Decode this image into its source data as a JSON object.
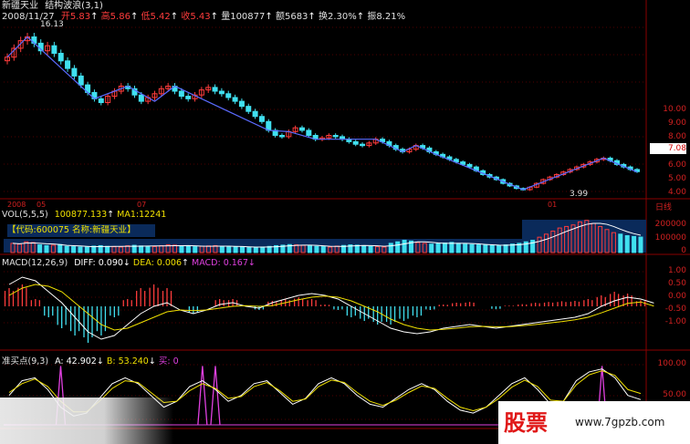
{
  "header": {
    "stock_name": "新疆天业",
    "indicator": "结构波浪(3,1)",
    "date": "2008/11/27",
    "open_label": "开",
    "open_value": "5.83",
    "high_label": "高",
    "high_value": "5.86",
    "low_label": "低",
    "low_value": "5.42",
    "close_label": "收",
    "close_value": "5.43",
    "volume_label": "量",
    "volume_value": "100877",
    "amount_label": "额",
    "amount_value": "5683",
    "turnover_label": "换",
    "turnover_value": "2.30%",
    "amplitude_label": "振",
    "amplitude_value": "8.21%"
  },
  "price_panel": {
    "y_ticks": [
      "10.00",
      "9.00",
      "8.00",
      "7.00",
      "6.00",
      "5.00",
      "4.00"
    ],
    "current_price": "7.08",
    "date_labels": [
      "2008",
      "05",
      "07",
      "01"
    ],
    "right_label": "日线",
    "high_mark": "16.13",
    "low_mark": "3.99"
  },
  "volume_panel": {
    "title": "VOL(5,5,5)",
    "value": "100877.133",
    "ma_label": "MA1:12241",
    "code_label": "【代码:600075 名称:新疆天业】",
    "y_ticks": [
      "200000",
      "100000",
      "0"
    ]
  },
  "macd_panel": {
    "title": "MACD(12,26,9)",
    "diff": "DIFF: 0.090",
    "dea": "DEA: 0.006",
    "macd": "MACD: 0.167",
    "y_ticks": [
      "1.00",
      "0.50",
      "0.00",
      "-0.50",
      "-1.00"
    ]
  },
  "kdj_panel": {
    "title": "准买点(9,3)",
    "a_value": "A: 42.902",
    "b_value": "B: 53.240",
    "buy_label": "买: 0",
    "y_ticks": [
      "100.00",
      "50.00"
    ]
  },
  "watermark": {
    "brand": "股票",
    "url": "www.7gpzb.com"
  },
  "colors": {
    "up": "#ff3c3c",
    "down": "#40e0f0",
    "wave": "#5a6bff",
    "white_line": "#ffffff",
    "yellow_line": "#f0e000",
    "magenta": "#e040e0",
    "grid": "#8a0000",
    "label_red": "#d02020"
  },
  "chart_data": [
    {
      "type": "candlestick",
      "title": "结构波浪(3,1)",
      "ylim": [
        3.5,
        17
      ],
      "close_series_approx": [
        14.5,
        15.2,
        15.8,
        16.1,
        15.6,
        15.0,
        15.4,
        14.8,
        14.2,
        13.6,
        13.0,
        12.3,
        11.7,
        11.2,
        10.9,
        11.4,
        11.8,
        12.2,
        12.0,
        11.5,
        11.0,
        11.3,
        11.6,
        12.0,
        12.2,
        11.8,
        11.4,
        11.2,
        11.5,
        11.9,
        12.1,
        11.8,
        11.6,
        11.3,
        11.0,
        10.6,
        10.2,
        9.8,
        9.4,
        8.7,
        8.3,
        8.2,
        8.6,
        8.9,
        8.7,
        8.3,
        8.0,
        8.1,
        8.3,
        8.2,
        8.0,
        7.8,
        7.6,
        7.5,
        7.7,
        8.0,
        7.8,
        7.5,
        7.2,
        7.0,
        7.2,
        7.5,
        7.3,
        7.0,
        6.8,
        6.6,
        6.4,
        6.2,
        6.0,
        5.8,
        5.5,
        5.2,
        5.0,
        4.8,
        4.5,
        4.3,
        4.1,
        4.0,
        4.2,
        4.5,
        4.8,
        5.0,
        5.2,
        5.4,
        5.6,
        5.8,
        6.0,
        6.2,
        6.4,
        6.5,
        6.3,
        6.0,
        5.8,
        5.6,
        5.43
      ],
      "annotations": [
        "16.13",
        "3.99"
      ],
      "wave_points_approx": [
        [
          0,
          14.5
        ],
        [
          3,
          16.1
        ],
        [
          13,
          11.2
        ],
        [
          18,
          12.2
        ],
        [
          22,
          11.0
        ],
        [
          25,
          12.2
        ],
        [
          39,
          8.7
        ],
        [
          42,
          8.6
        ],
        [
          46,
          8.0
        ],
        [
          55,
          8.0
        ],
        [
          59,
          7.0
        ],
        [
          61,
          7.5
        ],
        [
          64,
          6.8
        ],
        [
          77,
          4.0
        ],
        [
          89,
          6.5
        ],
        [
          94,
          5.4
        ]
      ]
    },
    {
      "type": "bar",
      "title": "VOL(5,5,5)",
      "ylim": [
        0,
        220000
      ],
      "values_approx": [
        60000,
        55000,
        70000,
        65000,
        50000,
        45000,
        48000,
        52000,
        40000,
        38000,
        36000,
        35000,
        42000,
        45000,
        40000,
        38000,
        36000,
        44000,
        47000,
        43000,
        41000,
        39000,
        45000,
        50000,
        48000,
        42000,
        40000,
        38000,
        41000,
        43000,
        45000,
        40000,
        38000,
        36000,
        37000,
        35000,
        34000,
        36000,
        40000,
        45000,
        48000,
        52000,
        50000,
        47000,
        44000,
        40000,
        38000,
        36000,
        42000,
        46000,
        50000,
        48000,
        44000,
        40000,
        38000,
        36000,
        60000,
        70000,
        80000,
        75000,
        65000,
        60000,
        55000,
        58000,
        62000,
        66000,
        60000,
        55000,
        52000,
        50000,
        48000,
        46000,
        45000,
        50000,
        55000,
        60000,
        70000,
        80000,
        100000,
        120000,
        140000,
        160000,
        170000,
        180000,
        200000,
        210000,
        190000,
        170000,
        150000,
        130000,
        120000,
        110000,
        105000,
        100877
      ]
    },
    {
      "type": "line",
      "title": "MACD(12,26,9)",
      "ylim": [
        -1.1,
        1.1
      ],
      "series": [
        {
          "name": "DIFF",
          "values_approx": [
            0.6,
            0.8,
            0.7,
            0.4,
            0.1,
            -0.3,
            -0.7,
            -0.9,
            -0.8,
            -0.5,
            -0.2,
            0.0,
            0.1,
            -0.1,
            -0.2,
            -0.1,
            0.05,
            0.1,
            0.0,
            -0.05,
            0.1,
            0.2,
            0.3,
            0.35,
            0.3,
            0.2,
            0.0,
            -0.2,
            -0.4,
            -0.6,
            -0.7,
            -0.75,
            -0.7,
            -0.6,
            -0.55,
            -0.5,
            -0.55,
            -0.6,
            -0.55,
            -0.5,
            -0.45,
            -0.4,
            -0.35,
            -0.3,
            -0.2,
            0.0,
            0.15,
            0.25,
            0.2,
            0.09
          ]
        },
        {
          "name": "DEA",
          "values_approx": [
            0.3,
            0.5,
            0.6,
            0.55,
            0.4,
            0.1,
            -0.2,
            -0.5,
            -0.65,
            -0.6,
            -0.45,
            -0.3,
            -0.15,
            -0.1,
            -0.12,
            -0.1,
            -0.05,
            0.0,
            0.02,
            0.0,
            0.02,
            0.1,
            0.18,
            0.25,
            0.28,
            0.25,
            0.15,
            0.0,
            -0.15,
            -0.35,
            -0.5,
            -0.6,
            -0.65,
            -0.63,
            -0.6,
            -0.56,
            -0.55,
            -0.56,
            -0.56,
            -0.53,
            -0.5,
            -0.46,
            -0.42,
            -0.37,
            -0.3,
            -0.18,
            -0.05,
            0.08,
            0.12,
            0.006
          ]
        },
        {
          "name": "MACD",
          "values_approx": [
            0.5,
            0.6,
            0.2,
            -0.3,
            -0.6,
            -0.8,
            -1.0,
            -0.8,
            -0.3,
            0.2,
            0.5,
            0.6,
            0.5,
            0.0,
            -0.2,
            0.0,
            0.2,
            0.2,
            0.0,
            -0.1,
            0.15,
            0.2,
            0.25,
            0.2,
            0.05,
            -0.1,
            -0.3,
            -0.4,
            -0.5,
            -0.5,
            -0.4,
            -0.3,
            -0.1,
            0.05,
            0.1,
            0.12,
            0.0,
            -0.08,
            0.02,
            0.06,
            0.1,
            0.12,
            0.14,
            0.15,
            0.2,
            0.3,
            0.4,
            0.35,
            0.167
          ]
        }
      ]
    },
    {
      "type": "line",
      "title": "准买点(9,3)",
      "ylim": [
        0,
        110
      ],
      "series": [
        {
          "name": "A",
          "values_approx": [
            50,
            75,
            80,
            60,
            30,
            15,
            20,
            45,
            70,
            80,
            70,
            50,
            30,
            40,
            65,
            75,
            60,
            40,
            50,
            70,
            75,
            55,
            35,
            45,
            70,
            80,
            70,
            50,
            35,
            30,
            45,
            60,
            70,
            60,
            40,
            25,
            20,
            30,
            50,
            70,
            80,
            60,
            35,
            40,
            75,
            90,
            95,
            80,
            50,
            42.9
          ]
        },
        {
          "name": "B",
          "values_approx": [
            55,
            70,
            78,
            65,
            40,
            22,
            22,
            40,
            62,
            75,
            72,
            55,
            38,
            40,
            58,
            70,
            62,
            45,
            48,
            65,
            72,
            58,
            40,
            44,
            65,
            76,
            72,
            55,
            40,
            33,
            42,
            55,
            66,
            62,
            45,
            30,
            24,
            30,
            45,
            64,
            76,
            65,
            42,
            40,
            68,
            85,
            92,
            84,
            60,
            53.24
          ]
        }
      ],
      "buy_signals_index_approx": [
        4,
        15,
        16,
        46
      ]
    }
  ]
}
